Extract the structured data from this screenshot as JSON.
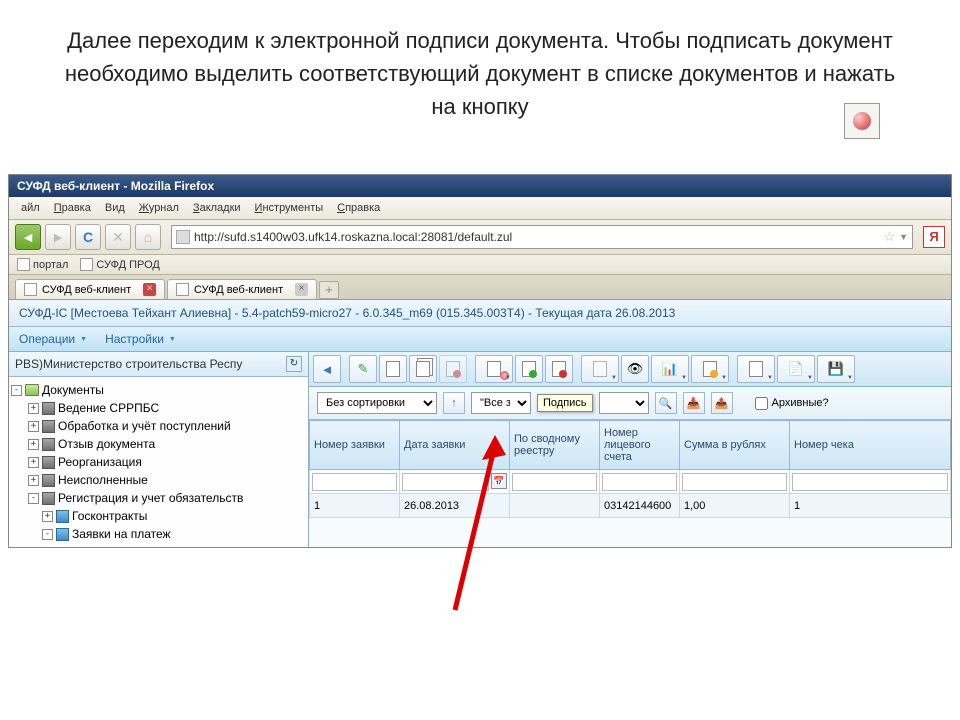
{
  "instruction": "Далее переходим к электронной подписи документа. Чтобы подписать документ необходимо выделить соответствующий документ в списке документов и нажать на кнопку",
  "window": {
    "title": "СУФД веб-клиент - Mozilla Firefox"
  },
  "menubar": {
    "file": "айл",
    "edit": "Правка",
    "view": "Вид",
    "journal": "Журнал",
    "bookmarks": "Закладки",
    "tools": "Инструменты",
    "help": "Справка"
  },
  "nav": {
    "url": "http://sufd.s1400w03.ufk14.roskazna.local:28081/default.zul"
  },
  "bookmarks": {
    "portal": "портал",
    "sufd": "СУФД ПРОД"
  },
  "tabs": {
    "t1": "СУФД веб-клиент",
    "t2": "СУФД веб-клиент"
  },
  "status": "СУФД-IC [Местоева Тейхант Алиевна] - 5.4-patch59-micro27 - 6.0.345_m69 (015.345.003T4) - Текущая дата 26.08.2013",
  "appmenu": {
    "ops": "Операции",
    "settings": "Настройки"
  },
  "sidebar": {
    "head": "PBS)Министерство строительства Респу",
    "root": "Документы",
    "n1": "Ведение СРРПБС",
    "n2": "Обработка и учёт поступлений",
    "n3": "Отзыв документа",
    "n4": "Реорганизация",
    "n5": "Неисполненные",
    "n6": "Регистрация и учет обязательств",
    "n61": "Госконтракты",
    "n62": "Заявки на платеж"
  },
  "filter": {
    "sort": "Без сортировки",
    "scope": "\"Все з",
    "archive": "Архивные?"
  },
  "tooltip": "Подпись",
  "cols": {
    "c1": "Номер заявки",
    "c2": "Дата заявки",
    "c3": "По сводному реестру",
    "c4": "Номер лицевого счета",
    "c5": "Сумма в рублях",
    "c6": "Номер чека"
  },
  "row": {
    "num": "1",
    "date": "26.08.2013",
    "svod": "",
    "acct": "03142144600",
    "sum": "1,00",
    "chk": "1"
  }
}
